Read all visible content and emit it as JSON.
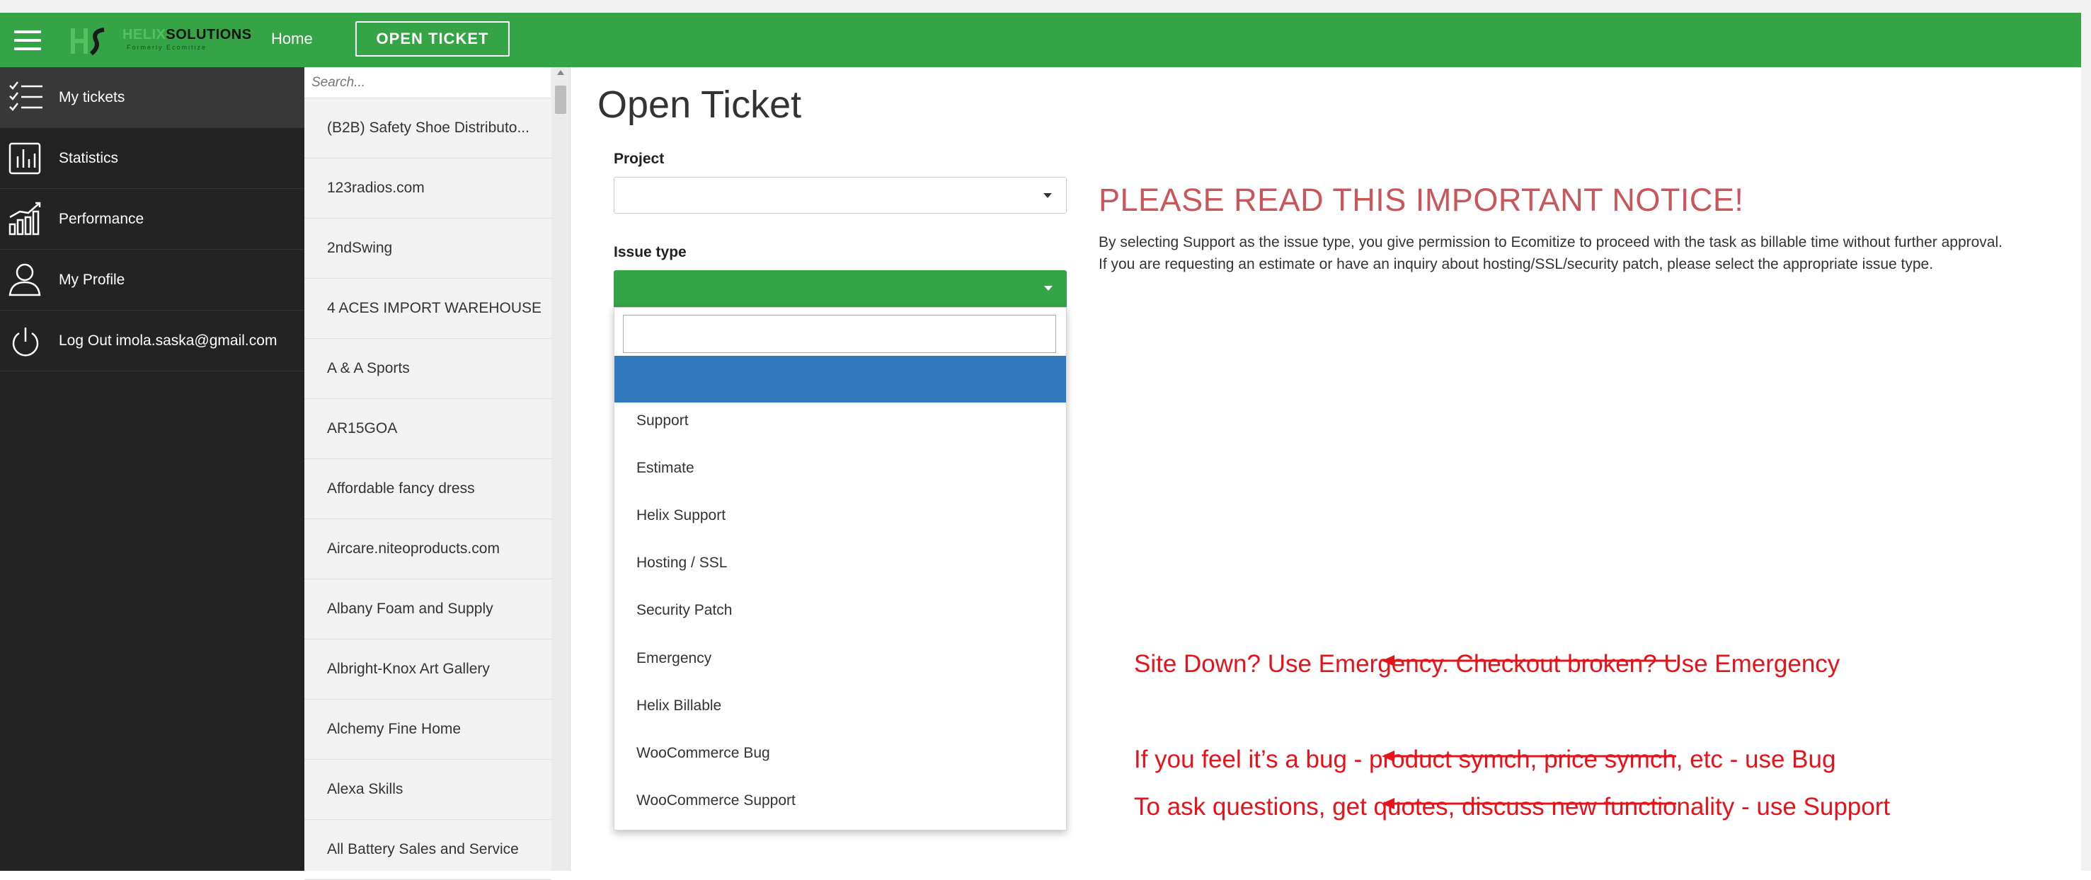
{
  "header": {
    "logo_brand": "HELIX",
    "logo_brand_rest": "SOLUTIONS",
    "logo_sub": "Formerly Ecomitize",
    "home_label": "Home",
    "open_ticket_label": "OPEN TICKET"
  },
  "sidebar": {
    "items": [
      {
        "label": "My tickets",
        "icon": "checklist-icon"
      },
      {
        "label": "Statistics",
        "icon": "bar-chart-icon"
      },
      {
        "label": "Performance",
        "icon": "performance-chart-icon"
      },
      {
        "label": "My Profile",
        "icon": "user-icon"
      },
      {
        "label": "Log Out imola.saska@gmail.com",
        "icon": "power-icon"
      }
    ]
  },
  "projects": {
    "search_placeholder": "Search...",
    "items": [
      "(B2B) Safety Shoe Distributo...",
      "123radios.com",
      "2ndSwing",
      "4 ACES IMPORT WAREHOUSE",
      "A & A Sports",
      "AR15GOA",
      "Affordable fancy dress",
      "Aircare.niteoproducts.com",
      "Albany Foam and Supply",
      "Albright-Knox Art Gallery",
      "Alchemy Fine Home",
      "Alexa Skills",
      "All Battery Sales and Service"
    ]
  },
  "main": {
    "title": "Open Ticket",
    "project_label": "Project",
    "issue_type_label": "Issue type",
    "issue_options": [
      "Support",
      "Estimate",
      "Helix Support",
      "Hosting / SSL",
      "Security Patch",
      "Emergency",
      "Helix Billable",
      "WooCommerce Bug",
      "WooCommerce Support"
    ]
  },
  "notice": {
    "title": "PLEASE READ THIS IMPORTANT NOTICE!",
    "line1": "By selecting Support as the issue type, you give permission to Ecomitize to proceed with the task as billable time without further approval.",
    "line2": "If you are requesting an estimate or have an inquiry about hosting/SSL/security patch, please select the appropriate issue type."
  },
  "annotations": {
    "emergency": "Site Down? Use Emergency. Checkout broken? Use Emergency",
    "bug": "If you feel it’s a bug - product symch, price symch, etc - use Bug",
    "support": "To ask questions, get quotes, discuss new functionality - use Support"
  },
  "colors": {
    "header_green": "#34a447",
    "sidebar_dark": "#232323",
    "highlight_blue": "#3278bd",
    "notice_red": "#c8565a",
    "annotation_red": "#e8121b"
  }
}
